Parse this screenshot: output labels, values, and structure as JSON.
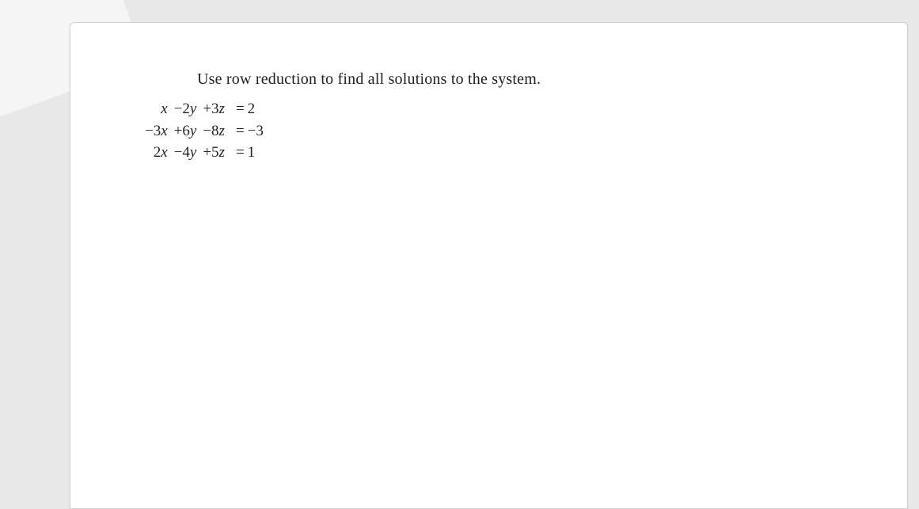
{
  "instruction": "Use row reduction to find all solutions to the system.",
  "equations": {
    "rows": [
      {
        "x": "x",
        "y": "−2y",
        "z": "+3z",
        "eq": "=",
        "rhs": "2"
      },
      {
        "x": "−3x",
        "y": "+6y",
        "z": "−8z",
        "eq": "=",
        "rhs": "−3"
      },
      {
        "x": "2x",
        "y": "−4y",
        "z": "+5z",
        "eq": "=",
        "rhs": "1"
      }
    ]
  }
}
